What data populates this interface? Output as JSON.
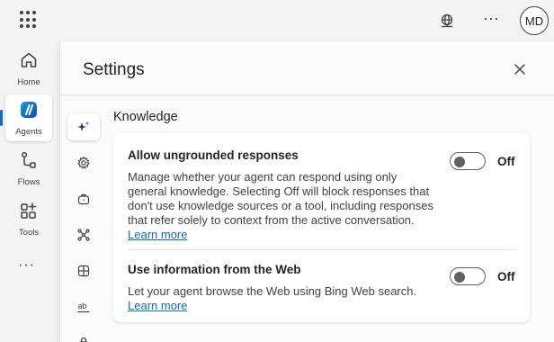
{
  "header": {
    "apps_icon": "waffle-icon",
    "environment_icon": "globe-icon",
    "more_label": "···",
    "avatar_initials": "MD"
  },
  "rail": {
    "items": [
      {
        "label": "Home",
        "icon": "home-icon"
      },
      {
        "label": "Agents",
        "icon": "agents-icon"
      },
      {
        "label": "Flows",
        "icon": "flows-icon"
      },
      {
        "label": "Tools",
        "icon": "tools-icon"
      }
    ],
    "more_label": "···",
    "accent": "#0f6cbd"
  },
  "panel": {
    "title": "Settings",
    "close_icon": "close-icon",
    "section_title": "Knowledge",
    "settings": [
      {
        "title": "Allow ungrounded responses",
        "description": "Manage whether your agent can respond using only general knowledge. Selecting Off will block responses that don't use knowledge sources or a tool, including responses that refer solely to context from the active conversation.",
        "link": "Learn more",
        "state": "Off"
      },
      {
        "title": "Use information from the Web",
        "description": "Let your agent browse the Web using Bing Web search.",
        "link": "Learn more",
        "state": "Off"
      }
    ]
  }
}
